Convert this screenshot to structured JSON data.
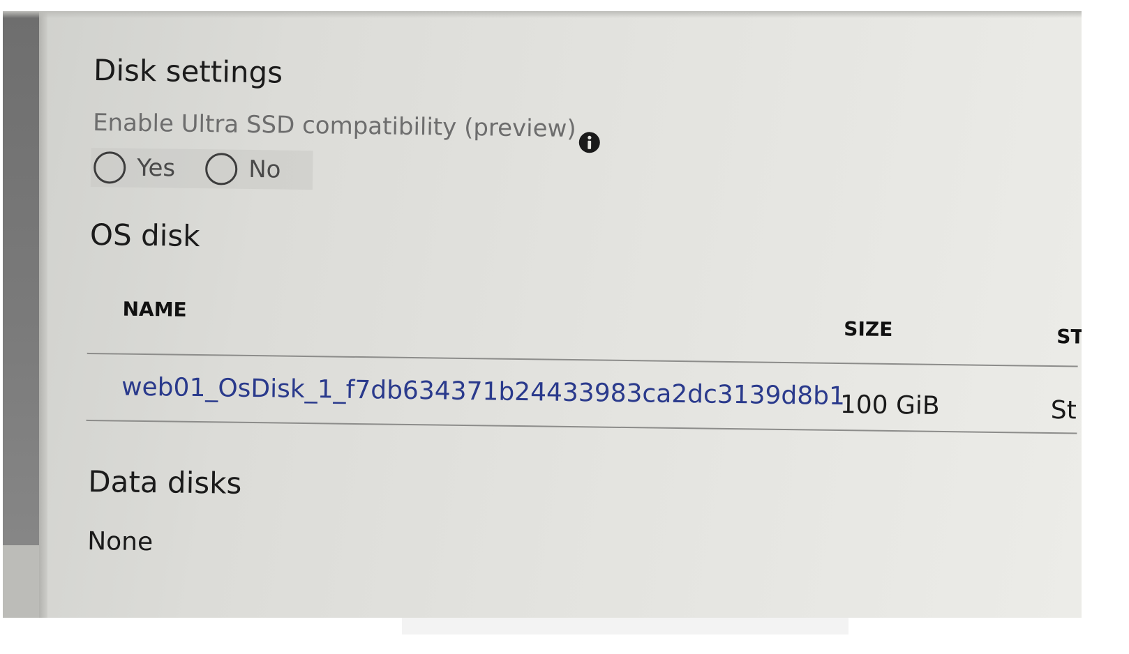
{
  "disk_settings": {
    "title": "Disk settings",
    "ultra_ssd_label": "Enable Ultra SSD compatibility (preview)",
    "info_icon": "info-icon",
    "options": [
      {
        "label": "Yes",
        "selected": false
      },
      {
        "label": "No",
        "selected": false
      }
    ]
  },
  "os_disk": {
    "title": "OS disk",
    "columns": [
      "NAME",
      "SIZE",
      "ST"
    ],
    "rows": [
      {
        "name": "web01_OsDisk_1_f7db634371b24433983ca2dc3139d8b1",
        "size": "100 GiB",
        "storage": "St"
      }
    ]
  },
  "data_disks": {
    "title": "Data disks",
    "value": "None"
  },
  "colors": {
    "link": "#2a3a8c",
    "text": "#1b1b1b",
    "muted": "#6d6d6d"
  }
}
